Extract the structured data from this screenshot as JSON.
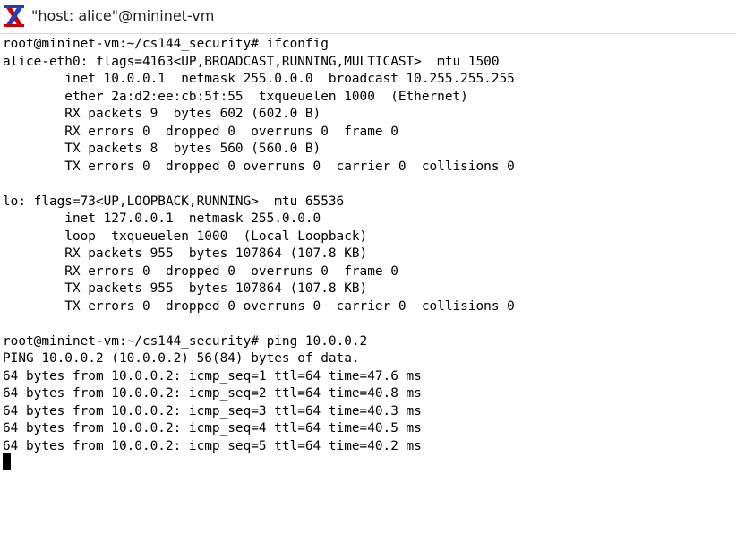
{
  "window": {
    "title": "\"host: alice\"@mininet-vm",
    "icon": "x11-xterm-icon"
  },
  "terminal": {
    "lines": [
      "root@mininet-vm:~/cs144_security# ifconfig",
      "alice-eth0: flags=4163<UP,BROADCAST,RUNNING,MULTICAST>  mtu 1500",
      "        inet 10.0.0.1  netmask 255.0.0.0  broadcast 10.255.255.255",
      "        ether 2a:d2:ee:cb:5f:55  txqueuelen 1000  (Ethernet)",
      "        RX packets 9  bytes 602 (602.0 B)",
      "        RX errors 0  dropped 0  overruns 0  frame 0",
      "        TX packets 8  bytes 560 (560.0 B)",
      "        TX errors 0  dropped 0 overruns 0  carrier 0  collisions 0",
      "",
      "lo: flags=73<UP,LOOPBACK,RUNNING>  mtu 65536",
      "        inet 127.0.0.1  netmask 255.0.0.0",
      "        loop  txqueuelen 1000  (Local Loopback)",
      "        RX packets 955  bytes 107864 (107.8 KB)",
      "        RX errors 0  dropped 0  overruns 0  frame 0",
      "        TX packets 955  bytes 107864 (107.8 KB)",
      "        TX errors 0  dropped 0 overruns 0  carrier 0  collisions 0",
      "",
      "root@mininet-vm:~/cs144_security# ping 10.0.0.2",
      "PING 10.0.0.2 (10.0.0.2) 56(84) bytes of data.",
      "64 bytes from 10.0.0.2: icmp_seq=1 ttl=64 time=47.6 ms",
      "64 bytes from 10.0.0.2: icmp_seq=2 ttl=64 time=40.8 ms",
      "64 bytes from 10.0.0.2: icmp_seq=3 ttl=64 time=40.3 ms",
      "64 bytes from 10.0.0.2: icmp_seq=4 ttl=64 time=40.5 ms",
      "64 bytes from 10.0.0.2: icmp_seq=5 ttl=64 time=40.2 ms"
    ]
  },
  "colors": {
    "background": "#ffffff",
    "text": "#000000",
    "icon_red": "#cc0000",
    "icon_blue": "#1f3fbf"
  }
}
